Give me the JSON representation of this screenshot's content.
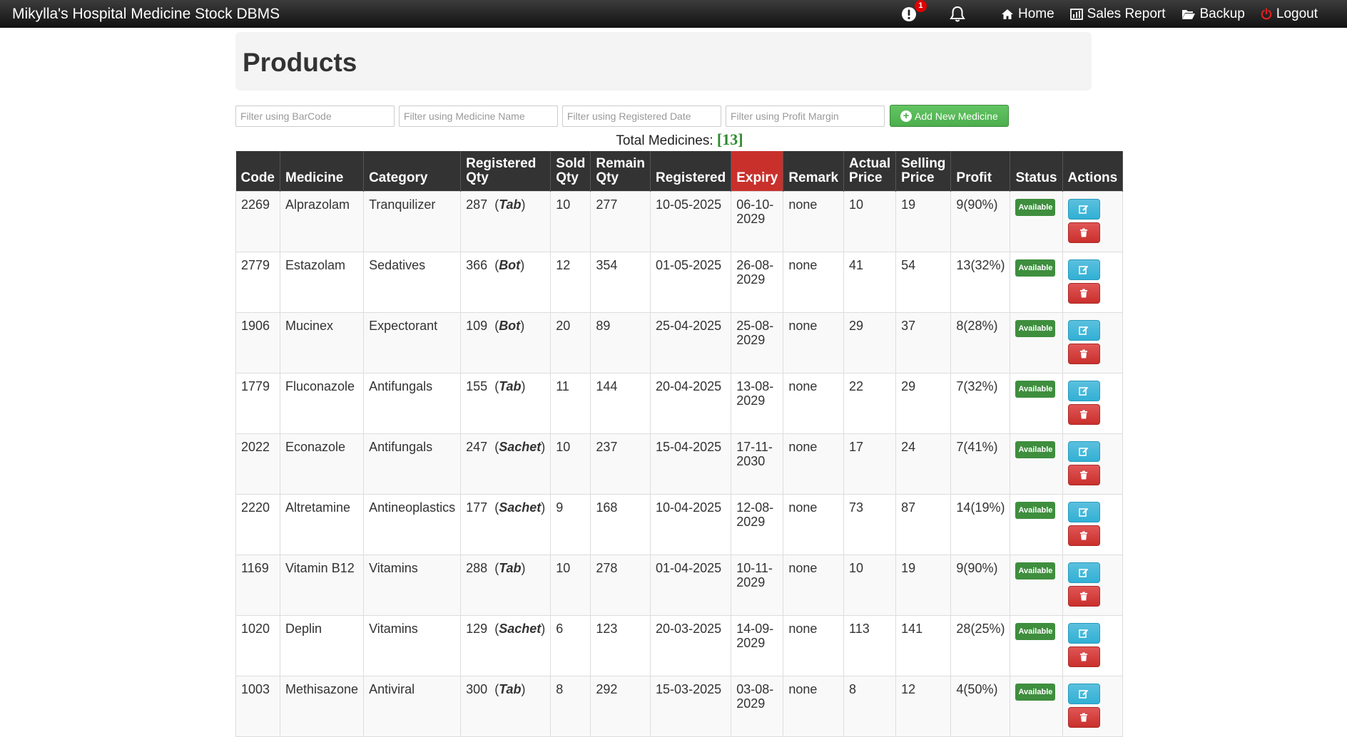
{
  "app": {
    "title": "Mikylla's Hospital Medicine Stock DBMS",
    "alert_count": "1",
    "nav": [
      {
        "label": "Home",
        "icon": "home-icon"
      },
      {
        "label": "Sales Report",
        "icon": "bar-chart-icon"
      },
      {
        "label": "Backup",
        "icon": "folder-open-icon"
      },
      {
        "label": "Logout",
        "icon": "power-icon"
      }
    ]
  },
  "page": {
    "heading": "Products",
    "filters": {
      "barcode_placeholder": "Filter using BarCode",
      "name_placeholder": "Filter using Medicine Name",
      "date_placeholder": "Filter using Registered Date",
      "margin_placeholder": "Filter using Profit Margin"
    },
    "add_button": "Add New Medicine",
    "total_label": "Total Medicines:",
    "total_count": "[13]"
  },
  "table": {
    "headers": {
      "code": "Code",
      "medicine": "Medicine",
      "category": "Category",
      "reg_qty": "Registered Qty",
      "sold_qty": "Sold Qty",
      "remain_qty": "Remain Qty",
      "registered": "Registered",
      "expiry": "Expiry",
      "remark": "Remark",
      "actual_price": "Actual Price",
      "selling_price": "Selling Price",
      "profit": "Profit",
      "status": "Status",
      "actions": "Actions"
    },
    "rows": [
      {
        "code": "2269",
        "medicine": "Alprazolam",
        "category": "Tranquilizer",
        "reg_qty": "287",
        "unit": "Tab",
        "sold": "10",
        "remain": "277",
        "registered": "10-05-2025",
        "expiry": "06-10-2029",
        "remark": "none",
        "actual": "10",
        "selling": "19",
        "profit": "9(90%)",
        "status": "Available"
      },
      {
        "code": "2779",
        "medicine": "Estazolam",
        "category": "Sedatives",
        "reg_qty": "366",
        "unit": "Bot",
        "sold": "12",
        "remain": "354",
        "registered": "01-05-2025",
        "expiry": "26-08-2029",
        "remark": "none",
        "actual": "41",
        "selling": "54",
        "profit": "13(32%)",
        "status": "Available"
      },
      {
        "code": "1906",
        "medicine": "Mucinex",
        "category": "Expectorant",
        "reg_qty": "109",
        "unit": "Bot",
        "sold": "20",
        "remain": "89",
        "registered": "25-04-2025",
        "expiry": "25-08-2029",
        "remark": "none",
        "actual": "29",
        "selling": "37",
        "profit": "8(28%)",
        "status": "Available"
      },
      {
        "code": "1779",
        "medicine": "Fluconazole",
        "category": "Antifungals",
        "reg_qty": "155",
        "unit": "Tab",
        "sold": "11",
        "remain": "144",
        "registered": "20-04-2025",
        "expiry": "13-08-2029",
        "remark": "none",
        "actual": "22",
        "selling": "29",
        "profit": "7(32%)",
        "status": "Available"
      },
      {
        "code": "2022",
        "medicine": "Econazole",
        "category": "Antifungals",
        "reg_qty": "247",
        "unit": "Sachet",
        "sold": "10",
        "remain": "237",
        "registered": "15-04-2025",
        "expiry": "17-11-2030",
        "remark": "none",
        "actual": "17",
        "selling": "24",
        "profit": "7(41%)",
        "status": "Available"
      },
      {
        "code": "2220",
        "medicine": "Altretamine",
        "category": "Antineoplastics",
        "reg_qty": "177",
        "unit": "Sachet",
        "sold": "9",
        "remain": "168",
        "registered": "10-04-2025",
        "expiry": "12-08-2029",
        "remark": "none",
        "actual": "73",
        "selling": "87",
        "profit": "14(19%)",
        "status": "Available"
      },
      {
        "code": "1169",
        "medicine": "Vitamin B12",
        "category": "Vitamins",
        "reg_qty": "288",
        "unit": "Tab",
        "sold": "10",
        "remain": "278",
        "registered": "01-04-2025",
        "expiry": "10-11-2029",
        "remark": "none",
        "actual": "10",
        "selling": "19",
        "profit": "9(90%)",
        "status": "Available"
      },
      {
        "code": "1020",
        "medicine": "Deplin",
        "category": "Vitamins",
        "reg_qty": "129",
        "unit": "Sachet",
        "sold": "6",
        "remain": "123",
        "registered": "20-03-2025",
        "expiry": "14-09-2029",
        "remark": "none",
        "actual": "113",
        "selling": "141",
        "profit": "28(25%)",
        "status": "Available"
      },
      {
        "code": "1003",
        "medicine": "Methisazone",
        "category": "Antiviral",
        "reg_qty": "300",
        "unit": "Tab",
        "sold": "8",
        "remain": "292",
        "registered": "15-03-2025",
        "expiry": "03-08-2029",
        "remark": "none",
        "actual": "8",
        "selling": "12",
        "profit": "4(50%)",
        "status": "Available"
      }
    ]
  }
}
